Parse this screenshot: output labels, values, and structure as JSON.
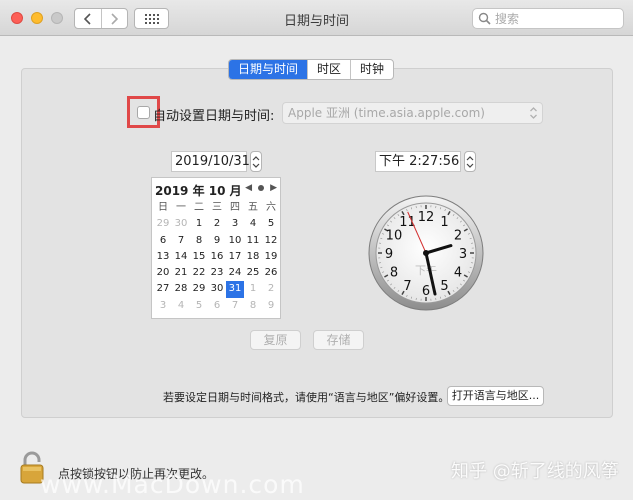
{
  "window": {
    "title": "日期与时间",
    "search_placeholder": "搜索"
  },
  "tabs": [
    {
      "label": "日期与时间",
      "active": true
    },
    {
      "label": "时区",
      "active": false
    },
    {
      "label": "时钟",
      "active": false
    }
  ],
  "auto_set": {
    "label": "自动设置日期与时间:",
    "checked": false,
    "server": "Apple 亚洲 (time.asia.apple.com)"
  },
  "date_field": "2019/10/31",
  "time_field": "下午  2:27:56",
  "calendar": {
    "month_label": "2019 年 10 月",
    "weekdays": [
      "日",
      "一",
      "二",
      "三",
      "四",
      "五",
      "六"
    ],
    "days": [
      [
        "29",
        "30",
        "1",
        "2",
        "3",
        "4",
        "5"
      ],
      [
        "6",
        "7",
        "8",
        "9",
        "10",
        "11",
        "12"
      ],
      [
        "13",
        "14",
        "15",
        "16",
        "17",
        "18",
        "19"
      ],
      [
        "20",
        "21",
        "22",
        "23",
        "24",
        "25",
        "26"
      ],
      [
        "27",
        "28",
        "29",
        "30",
        "31",
        "1",
        "2"
      ],
      [
        "3",
        "4",
        "5",
        "6",
        "7",
        "8",
        "9"
      ]
    ],
    "selected_day": "31"
  },
  "clock": {
    "numbers": [
      "12",
      "1",
      "2",
      "3",
      "4",
      "5",
      "6",
      "7",
      "8",
      "9",
      "10",
      "11"
    ],
    "ampm": "下午",
    "hour": 2,
    "minute": 27,
    "second": 56
  },
  "buttons": {
    "revert": "复原",
    "save": "存储",
    "open_region": "打开语言与地区..."
  },
  "hint": "若要设定日期与时间格式，请使用“语言与地区”偏好设置。",
  "lock_text": "点按锁按钮以防止再次更改。",
  "watermark": "www.MacDown.com",
  "credit": "知乎 @斩了线的风筝",
  "colors": {
    "accent": "#2c73e6",
    "annotation": "#e04848"
  }
}
